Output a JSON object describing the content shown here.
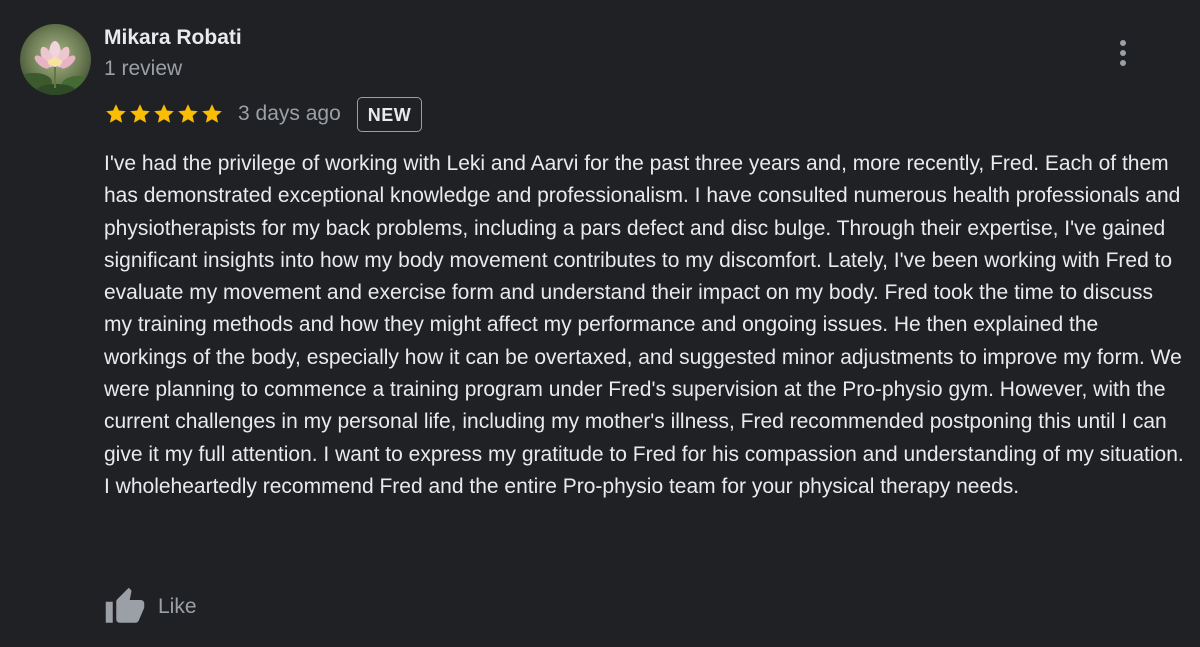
{
  "review": {
    "author_name": "Mikara Robati",
    "review_count": "1 review",
    "rating": 5,
    "rating_max": 5,
    "date": "3 days ago",
    "badge": "NEW",
    "text": "I've had the privilege of working with Leki and Aarvi for the past three years and, more recently, Fred. Each of them has demonstrated exceptional knowledge and professionalism. I have consulted numerous health professionals and physiotherapists for my back problems, including a pars defect and disc bulge. Through their expertise, I've gained significant insights into how my body movement contributes to my discomfort. Lately, I've been working with Fred to evaluate my movement and exercise form and understand their impact on my body. Fred took the time to discuss my training methods and how they might affect my performance and ongoing issues. He then explained the workings of the body, especially how it can be overtaxed, and suggested minor adjustments to improve my form. We were planning to commence a training program under Fred's supervision at the Pro-physio gym. However, with the current challenges in my personal life, including my mother's illness, Fred recommended postponing this until I can give it my full attention. I want to express my gratitude to Fred for his compassion and understanding of my situation. I wholeheartedly recommend Fred and the entire Pro-physio team for your physical therapy needs.",
    "like_label": "Like"
  },
  "icons": {
    "avatar": "lotus-flower-photo",
    "star": "star-icon",
    "menu": "more-vert-icon",
    "like": "thumb-up-icon"
  },
  "colors": {
    "background": "#202124",
    "text_primary": "#e8eaed",
    "text_secondary": "#9aa0a6",
    "star": "#fbbc04"
  }
}
